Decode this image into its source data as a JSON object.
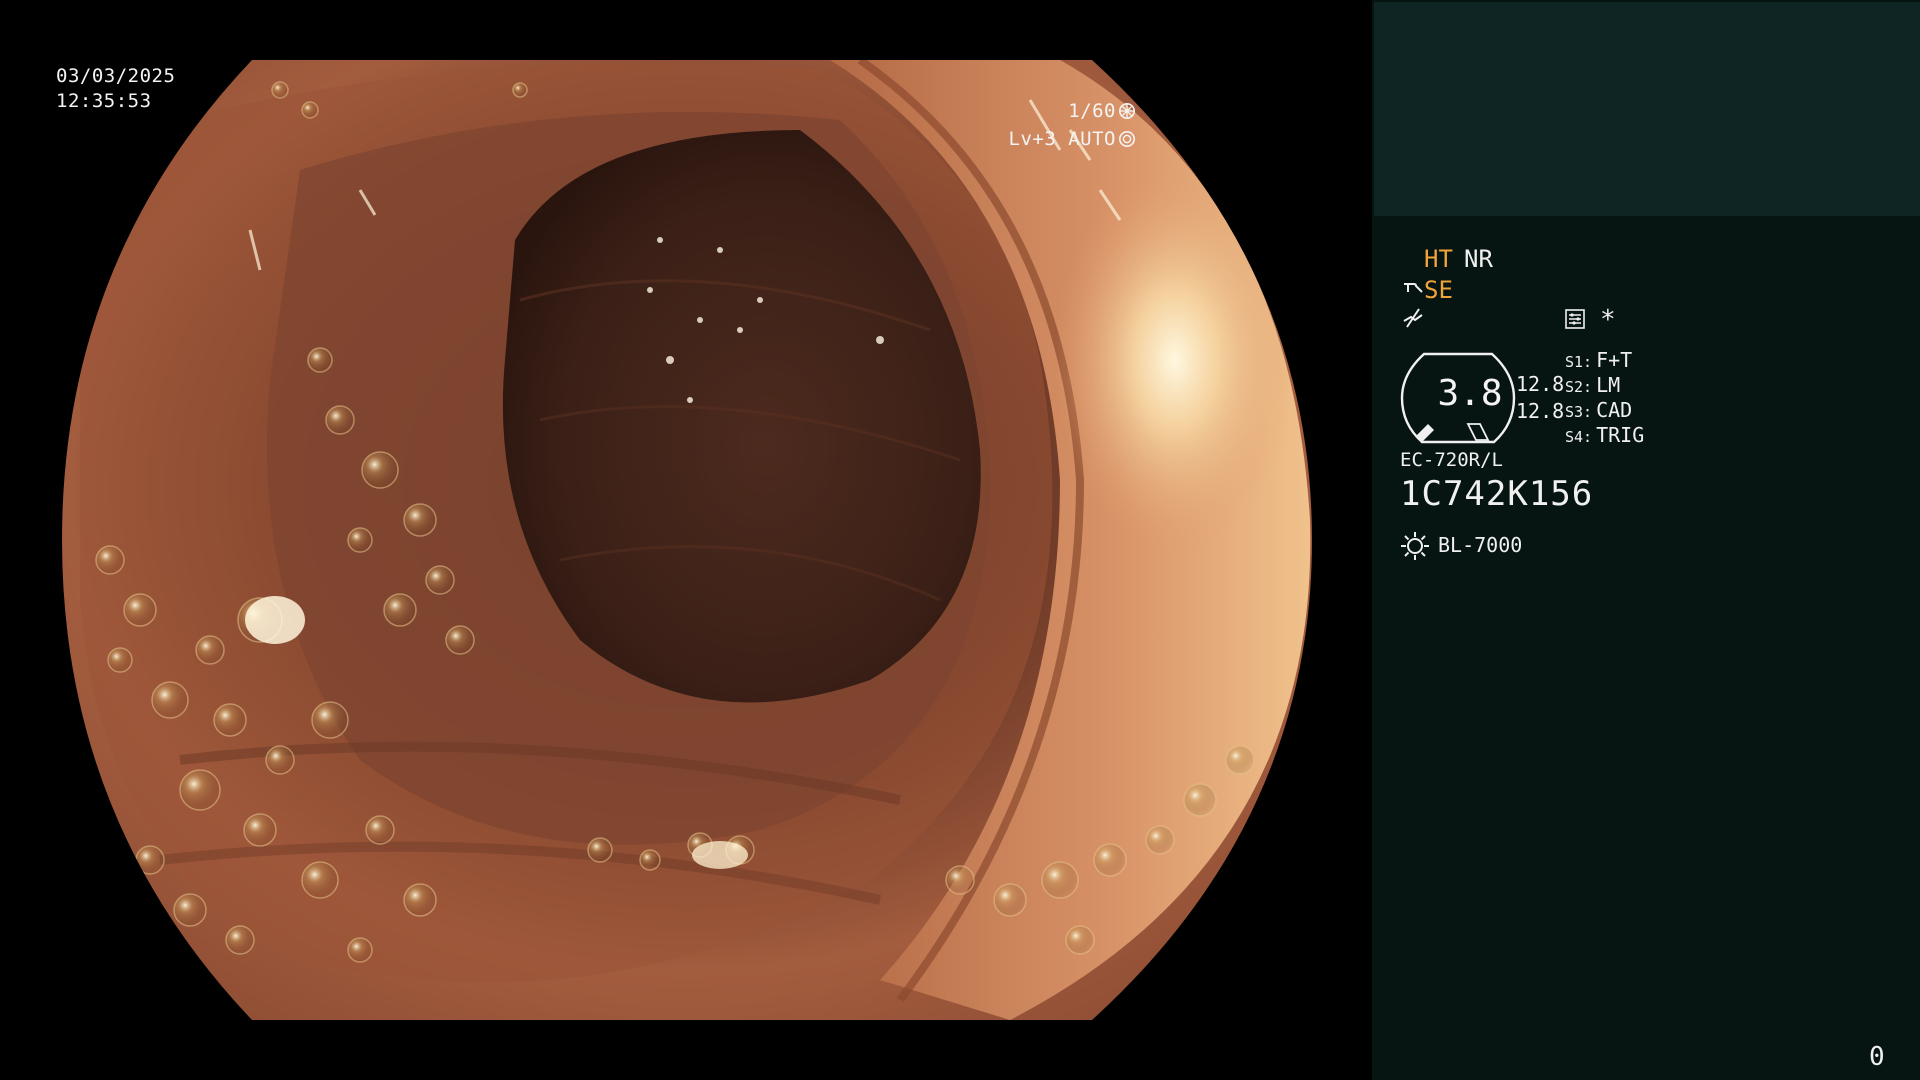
{
  "video": {
    "date": "03/03/2025",
    "time": "12:35:53",
    "shutter": "1/60",
    "iris": "Lv+3 AUTO"
  },
  "panel": {
    "ht": "HT",
    "nr": "NR",
    "se": "SE",
    "star": "*",
    "gauge_value": "3.8",
    "num_top": "12.8",
    "num_bottom": "12.8",
    "slots": [
      {
        "key": "S1:",
        "value": "F+T"
      },
      {
        "key": "S2:",
        "value": "LM"
      },
      {
        "key": "S3:",
        "value": "CAD"
      },
      {
        "key": "S4:",
        "value": "TRIG"
      }
    ],
    "scope_model": "EC-720R/L",
    "scope_serial": "1C742K156",
    "light_source": "BL-7000",
    "counter": "0"
  },
  "colors": {
    "accent_orange": "#f2a33a",
    "panel_bg": "#061412",
    "panel_top_bg": "#0f2523"
  },
  "icons": [
    "shutter-icon",
    "iris-icon",
    "se-icon",
    "flat-icon",
    "settings-icon",
    "sun-icon"
  ]
}
